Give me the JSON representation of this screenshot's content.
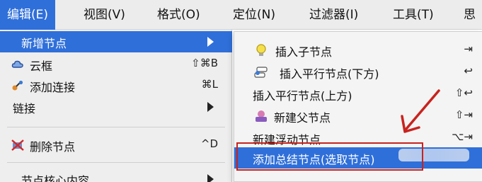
{
  "menubar": {
    "items": [
      {
        "label": "编辑(E)",
        "active": true
      },
      {
        "label": "视图(V)"
      },
      {
        "label": "格式(O)"
      },
      {
        "label": "定位(N)"
      },
      {
        "label": "过滤器(I)"
      },
      {
        "label": "工具(T)"
      },
      {
        "label": "思"
      }
    ]
  },
  "menu": {
    "items": [
      {
        "label": "新增节点",
        "has_submenu": true,
        "highlighted": true
      },
      {
        "label": "云框",
        "shortcut": "⇧⌘B",
        "icon": "cloud-icon"
      },
      {
        "label": "添加连接",
        "shortcut": "⌘L",
        "icon": "link-add-icon"
      },
      {
        "label": "链接",
        "has_submenu": true
      },
      {
        "label": "删除节点",
        "shortcut": "^D",
        "icon": "delete-node-icon"
      },
      {
        "label": "节点核心内容",
        "has_submenu": true
      }
    ]
  },
  "submenu": {
    "items": [
      {
        "label": "插入子节点",
        "shortcut": "⇥",
        "icon": "lightbulb-icon"
      },
      {
        "label": "插入平行节点(下方)",
        "shortcut": "↩",
        "icon": "sibling-node-icon"
      },
      {
        "label": "插入平行节点(上方)",
        "shortcut": "⇧↩"
      },
      {
        "label": "新建父节点",
        "shortcut": "⇧⇥",
        "icon": "parent-node-icon"
      },
      {
        "label": "新建浮动节点",
        "shortcut": "⌥⇥"
      },
      {
        "label": "添加总结节点(选取节点)",
        "highlighted": true
      }
    ]
  },
  "colors": {
    "accent": "#2f6fd9",
    "annotation": "#c8231e"
  }
}
